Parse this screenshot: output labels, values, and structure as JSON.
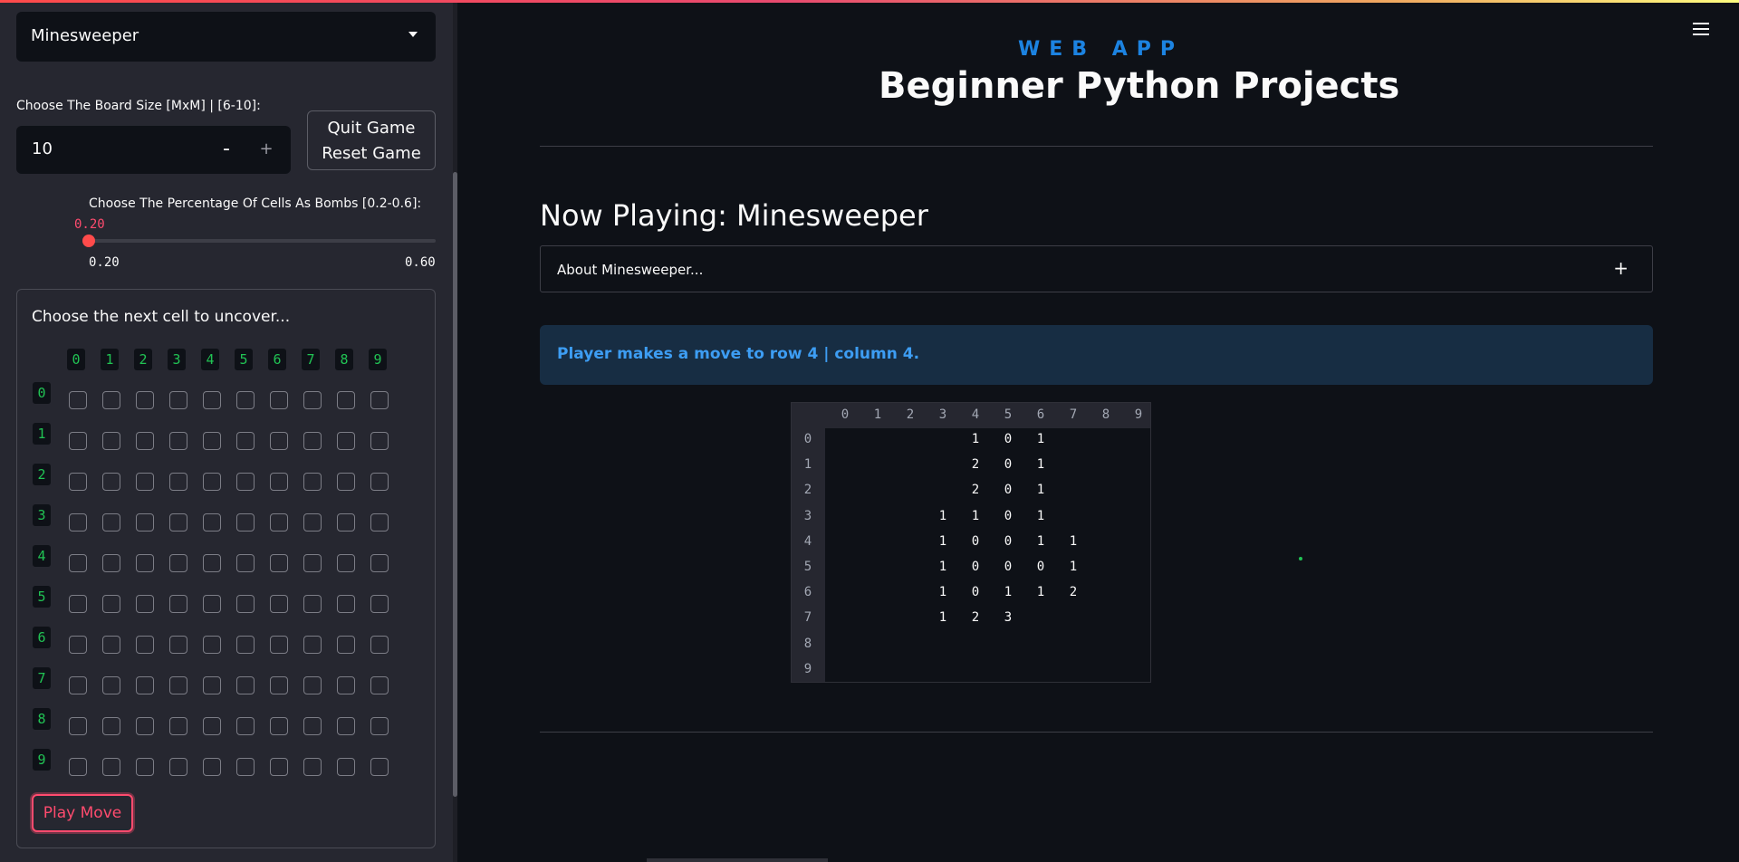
{
  "sidebar": {
    "game_select": {
      "value": "Minesweeper"
    },
    "board_size": {
      "label": "Choose The Board Size [MxM] | [6-10]:",
      "value": "10",
      "minus": "-",
      "plus": "+"
    },
    "quit_button": {
      "line1": "Quit Game",
      "line2": "Reset Game"
    },
    "bomb_slider": {
      "label": "Choose The Percentage Of Cells As Bombs [0.2-0.6]:",
      "value": "0.20",
      "value_fraction": 0.0,
      "min": "0.20",
      "max": "0.60"
    },
    "move_form": {
      "title": "Choose the next cell to uncover...",
      "columns": [
        "0",
        "1",
        "2",
        "3",
        "4",
        "5",
        "6",
        "7",
        "8",
        "9"
      ],
      "rows": [
        "0",
        "1",
        "2",
        "3",
        "4",
        "5",
        "6",
        "7",
        "8",
        "9"
      ],
      "play_button": "Play Move"
    }
  },
  "main": {
    "subtitle": "WEB APP",
    "title": "Beginner Python Projects",
    "now_playing": "Now Playing: Minesweeper",
    "expander_label": "About Minesweeper...",
    "expander_icon": "+",
    "info_message": "Player makes a move to row 4 | column 4.",
    "board": {
      "col_headers": [
        "0",
        "1",
        "2",
        "3",
        "4",
        "5",
        "6",
        "7",
        "8",
        "9"
      ],
      "row_headers": [
        "0",
        "1",
        "2",
        "3",
        "4",
        "5",
        "6",
        "7",
        "8",
        "9"
      ],
      "cells": [
        [
          "",
          "",
          "",
          "",
          "1",
          "0",
          "1",
          "",
          "",
          ""
        ],
        [
          "",
          "",
          "",
          "",
          "2",
          "0",
          "1",
          "",
          "",
          ""
        ],
        [
          "",
          "",
          "",
          "",
          "2",
          "0",
          "1",
          "",
          "",
          ""
        ],
        [
          "",
          "",
          "",
          "1",
          "1",
          "0",
          "1",
          "",
          "",
          ""
        ],
        [
          "",
          "",
          "",
          "1",
          "0",
          "0",
          "1",
          "1",
          "",
          ""
        ],
        [
          "",
          "",
          "",
          "1",
          "0",
          "0",
          "0",
          "1",
          "",
          ""
        ],
        [
          "",
          "",
          "",
          "1",
          "0",
          "1",
          "1",
          "2",
          "",
          ""
        ],
        [
          "",
          "",
          "",
          "1",
          "2",
          "3",
          "",
          "",
          "",
          ""
        ],
        [
          "",
          "",
          "",
          "",
          "",
          "",
          "",
          "",
          "",
          ""
        ],
        [
          "",
          "",
          "",
          "",
          "",
          "",
          "",
          "",
          "",
          ""
        ]
      ]
    }
  },
  "colors": {
    "background": "#0e1117",
    "sidebar": "#262730",
    "accent": "#ff4b4b",
    "info_blue": "#3d9df3",
    "green": "#21c354"
  },
  "icons": [
    "chevron-down-icon",
    "hamburger-menu-icon",
    "plus-icon"
  ]
}
